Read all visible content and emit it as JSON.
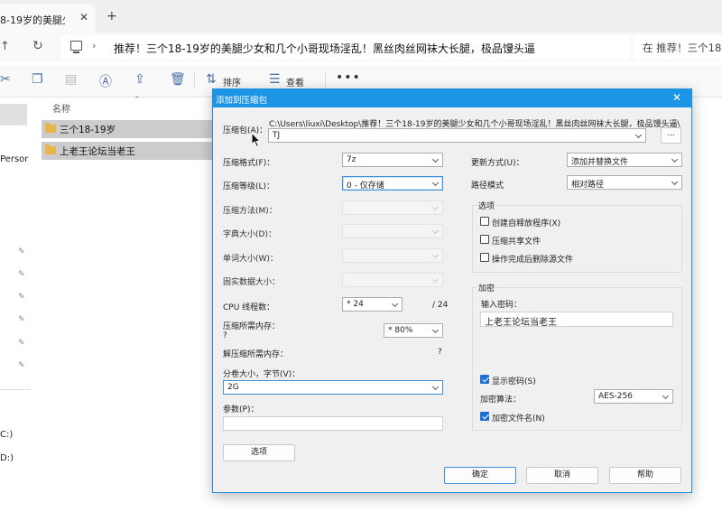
{
  "explorer": {
    "tab_title": "8-19岁的美腿少女和",
    "tab_close": "✕",
    "tab_new": "+",
    "nav_up": "↑",
    "nav_refresh": "↻",
    "addr_sep": "›",
    "address_path": "推荐！三个18-19岁的美腿少女和几个小哥现场淫乱！黑丝肉丝网袜大长腿，极品馒头逼",
    "search_text": "在 推荐！三个18-",
    "toolbar": {
      "sort_label": "排序",
      "view_label": "查看",
      "more": "•••",
      "icons": [
        "cut-icon",
        "copy-icon",
        "paste-icon",
        "rename-icon",
        "share-icon",
        "delete-icon",
        "sort-icon",
        "view-icon"
      ]
    },
    "column_header": "名称",
    "sidebar_fragments": {
      "persona": "Persor",
      "drive_c": "C:)",
      "drive_d": "D:)"
    },
    "files": [
      {
        "name": "三个18-19岁"
      },
      {
        "name": "上老王论坛当老王"
      }
    ]
  },
  "dialog": {
    "title": "添加到压缩包",
    "close": "✕",
    "archive_label": "压缩包(A)：",
    "archive_path": "C:\\Users\\liuxi\\Desktop\\推荐！三个18-19岁的美腿少女和几个小哥现场淫乱！黑丝肉丝网袜大长腿，极品馒头逼\\",
    "archive_name": "TJ",
    "browse_label": "...",
    "left": {
      "format_label": "压缩格式(F)：",
      "format_value": "7z",
      "level_label": "压缩等级(L)：",
      "level_value": "0 - 仅存储",
      "method_label": "压缩方法(M)：",
      "dict_label": "字典大小(D)：",
      "word_label": "单词大小(W)：",
      "solid_label": "固实数据大小：",
      "threads_label": "CPU 线程数：",
      "threads_value": "* 24",
      "threads_total": "/ 24",
      "mem_label": "压缩所需内存：",
      "mem_hint": "?",
      "mem_value": "* 80%",
      "decomp_mem_label": "解压缩所需内存：",
      "decomp_mem_value": "?",
      "volume_label": "分卷大小，字节(V)：",
      "volume_value": "2G",
      "params_label": "参数(P)：",
      "params_value": "",
      "options_button": "选项"
    },
    "right": {
      "update_label": "更新方式(U)：",
      "update_value": "添加并替换文件",
      "path_label": "路径模式",
      "path_value": "相对路径",
      "options_group": "选项",
      "sfx_label": "创建自释放程序(X)",
      "sfx_checked": false,
      "shared_label": "压缩共享文件",
      "shared_checked": false,
      "delete_label": "操作完成后删除源文件",
      "delete_checked": false,
      "encrypt_group": "加密",
      "password_label": "输入密码：",
      "password_value": "上老王论坛当老王",
      "show_password_label": "显示密码(S)",
      "show_password_checked": true,
      "method_label": "加密算法：",
      "method_value": "AES-256",
      "encrypt_names_label": "加密文件名(N)",
      "encrypt_names_checked": true
    },
    "buttons": {
      "ok": "确定",
      "cancel": "取消",
      "help": "帮助"
    }
  }
}
